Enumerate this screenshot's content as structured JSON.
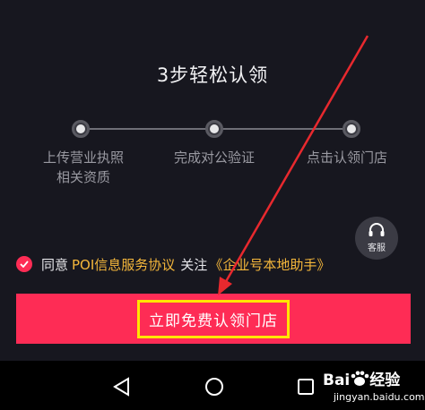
{
  "title": "3步轻松认领",
  "steps": [
    {
      "line1": "上传营业执照",
      "line2": "相关资质"
    },
    {
      "line1": "完成对公验证",
      "line2": ""
    },
    {
      "line1": "点击认领门店",
      "line2": ""
    }
  ],
  "help": {
    "label": "客服",
    "icon": "headset-icon"
  },
  "agreement": {
    "checked": true,
    "prefix": "同意",
    "link1": "POI信息服务协议",
    "middle": "关注",
    "link2": "《企业号本地助手》"
  },
  "claim_button": {
    "label": "立即免费认领门店"
  },
  "navbar": {
    "back": "back-icon",
    "home": "home-icon",
    "recent": "recent-apps-icon"
  },
  "watermark": {
    "brand": "Bai",
    "brand_suffix": "经验",
    "url": "jingyan.baidu.com"
  },
  "colors": {
    "background": "#17171f",
    "accent": "#fe2c55",
    "link": "#f5b73b",
    "highlight": "#ffe500",
    "arrow": "#e8292e"
  }
}
